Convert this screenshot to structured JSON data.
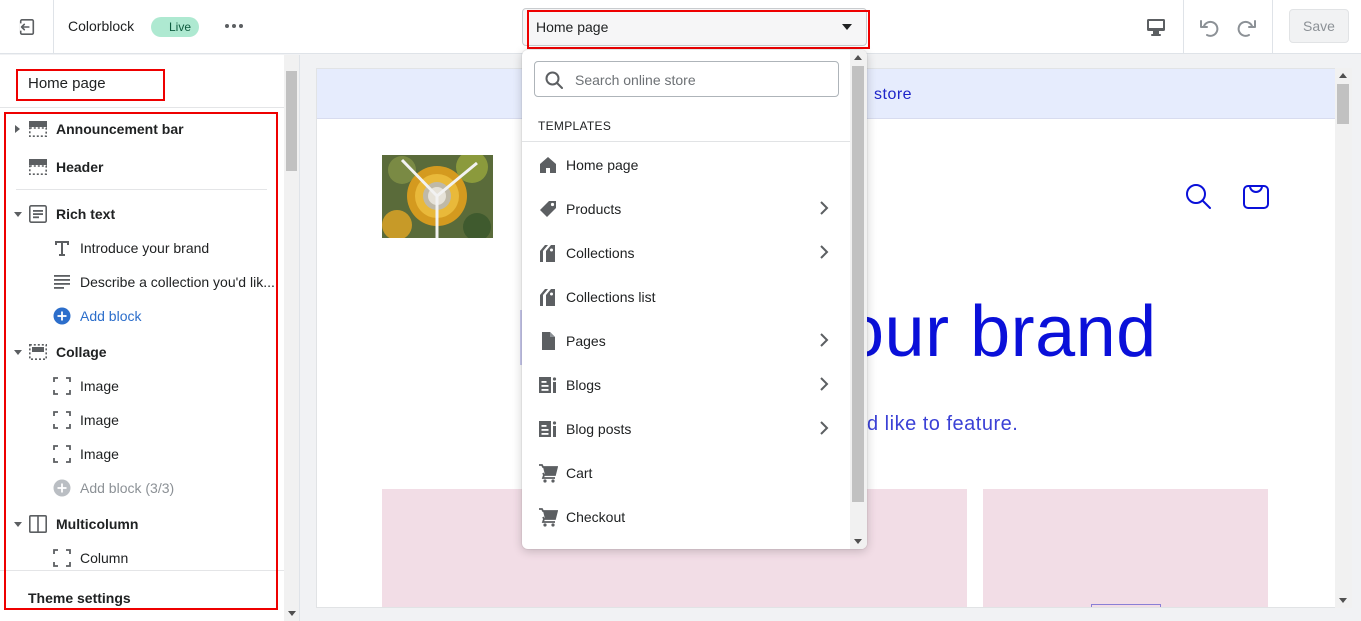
{
  "topbar": {
    "theme_name": "Colorblock",
    "live_badge": "Live",
    "page_selector": "Home page",
    "save_label": "Save"
  },
  "sidebar": {
    "title": "Home page",
    "sections": [
      {
        "label": "Announcement bar",
        "icon": "announcement-bar-icon",
        "expanded": false
      },
      {
        "label": "Header",
        "icon": "header-icon"
      },
      {
        "label": "Rich text",
        "icon": "rich-text-icon",
        "expanded": true,
        "blocks": [
          {
            "label": "Introduce your brand",
            "icon": "text-heading-icon"
          },
          {
            "label": "Describe a collection you'd lik...",
            "icon": "text-paragraph-icon"
          }
        ],
        "add_block": "Add block"
      },
      {
        "label": "Collage",
        "icon": "collage-icon",
        "expanded": true,
        "blocks": [
          {
            "label": "Image",
            "icon": "image-block-icon"
          },
          {
            "label": "Image",
            "icon": "image-block-icon"
          },
          {
            "label": "Image",
            "icon": "image-block-icon"
          }
        ],
        "add_block": "Add block (3/3)"
      },
      {
        "label": "Multicolumn",
        "icon": "multicolumn-icon",
        "expanded": true,
        "blocks": [
          {
            "label": "Column",
            "icon": "column-block-icon"
          }
        ]
      }
    ],
    "theme_settings": "Theme settings"
  },
  "preview": {
    "announcement": "store",
    "hero_title": "our brand",
    "hero_subtitle": "d like to feature."
  },
  "dropdown": {
    "search_placeholder": "Search online store",
    "heading": "TEMPLATES",
    "items": [
      {
        "label": "Home page",
        "icon": "home-icon",
        "has_submenu": false
      },
      {
        "label": "Products",
        "icon": "tag-icon",
        "has_submenu": true
      },
      {
        "label": "Collections",
        "icon": "collections-icon",
        "has_submenu": true
      },
      {
        "label": "Collections list",
        "icon": "collections-list-icon",
        "has_submenu": false
      },
      {
        "label": "Pages",
        "icon": "page-icon",
        "has_submenu": true
      },
      {
        "label": "Blogs",
        "icon": "blog-icon",
        "has_submenu": true
      },
      {
        "label": "Blog posts",
        "icon": "blog-post-icon",
        "has_submenu": true
      },
      {
        "label": "Cart",
        "icon": "cart-icon",
        "has_submenu": false
      },
      {
        "label": "Checkout",
        "icon": "checkout-icon",
        "has_submenu": false
      }
    ]
  },
  "colors": {
    "highlight": "#ee0000",
    "brand_blue": "#0a10d9",
    "link_blue": "#2c6ecb",
    "live_badge_bg": "#aee9d1"
  }
}
